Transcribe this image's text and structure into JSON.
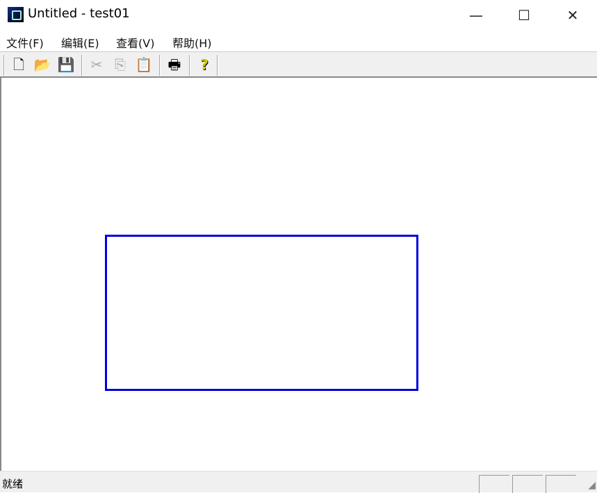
{
  "window": {
    "title": "Untitled - test01",
    "minimize": "—",
    "maximize": "☐",
    "close": "✕"
  },
  "menu": [
    "文件(F)",
    "编辑(E)",
    "查看(V)",
    "帮助(H)"
  ],
  "toolbar": {
    "new": "🗋",
    "open": "📂",
    "save": "💾",
    "cut": "✂",
    "copy": "⎘",
    "paste": "📋",
    "print": "🖶",
    "help": "?"
  },
  "status": {
    "text": "就绪"
  },
  "colors": {
    "rect": "#0000e0"
  }
}
